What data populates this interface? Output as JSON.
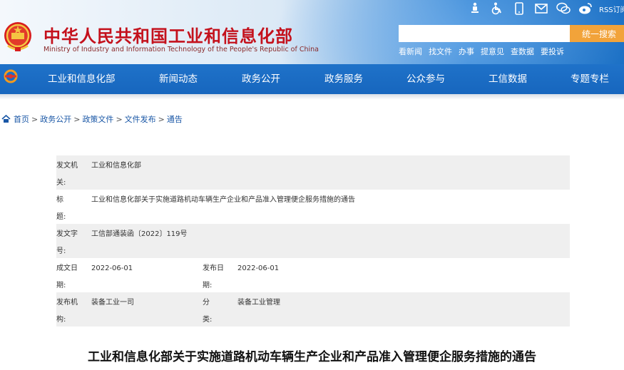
{
  "header": {
    "title_cn": "中华人民共和国工业和信息化部",
    "title_en": "Ministry of Industry and Information Technology of the People's Republic of China",
    "top_icons": [
      "accessibility-icon",
      "wheelchair-icon",
      "mobile-icon",
      "mail-icon",
      "wechat-icon",
      "weibo-icon"
    ],
    "rss_label": "RSS订阅",
    "search_placeholder": "",
    "search_button": "统一搜索",
    "quick_links": [
      "看新闻",
      "找文件",
      "办事",
      "提意见",
      "查数据",
      "要投诉"
    ]
  },
  "nav": {
    "items": [
      "工业和信息化部",
      "新闻动态",
      "政务公开",
      "政务服务",
      "公众参与",
      "工信数据",
      "专题专栏"
    ]
  },
  "breadcrumb": {
    "items": [
      "首页",
      "政务公开",
      "政策文件",
      "文件发布",
      "通告"
    ],
    "separator": ">"
  },
  "meta": {
    "issuer_label": "发文机关:",
    "issuer_value": "工业和信息化部",
    "title_label": "标题:",
    "title_value": "工业和信息化部关于实施道路机动车辆生产企业和产品准入管理便企服务措施的通告",
    "doc_number_label": "发文字号:",
    "doc_number_value": "工信部通装函〔2022〕119号",
    "written_date_label": "成文日期:",
    "written_date_value": "2022-06-01",
    "publish_date_label": "发布日期:",
    "publish_date_value": "2022-06-01",
    "publisher_label": "发布机构:",
    "publisher_value": "装备工业一司",
    "category_label": "分类:",
    "category_value": "装备工业管理"
  },
  "document": {
    "heading": "工业和信息化部关于实施道路机动车辆生产企业和产品准入管理便企服务措施的通告"
  },
  "colors": {
    "brand_red": "#c4111c",
    "nav_blue": "#1a6bc2",
    "search_orange": "#f2a33a",
    "link_blue": "#1a57a6"
  }
}
